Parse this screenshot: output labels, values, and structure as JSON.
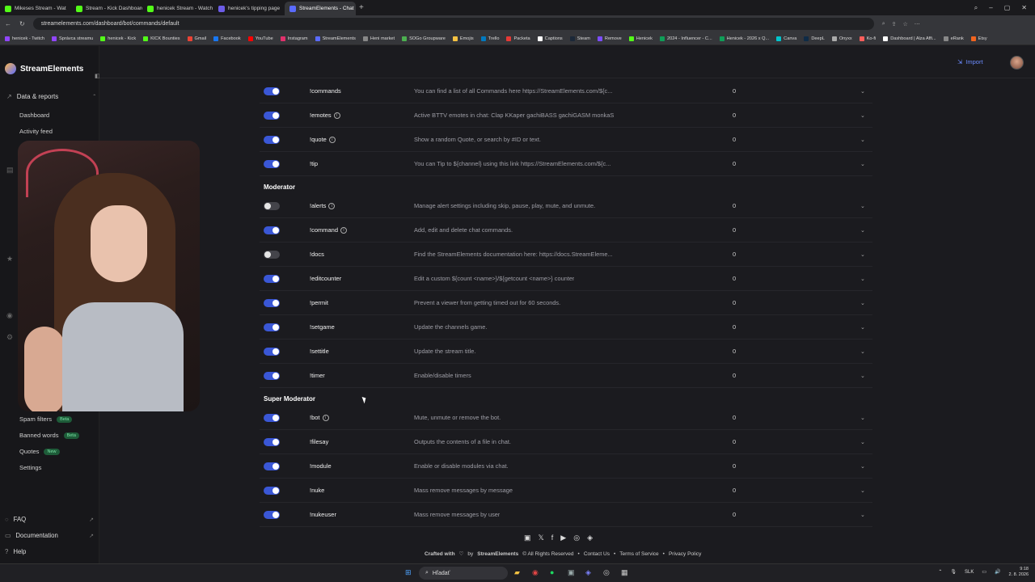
{
  "browser": {
    "tabs": [
      {
        "label": "Mikeses Stream - Wat",
        "color": "#53fc18"
      },
      {
        "label": "Stream - Kick Dashboard",
        "color": "#53fc18"
      },
      {
        "label": "henicek Stream - Watch",
        "color": "#53fc18"
      },
      {
        "label": "henicek's tipping page",
        "color": "#6c5ce7"
      },
      {
        "label": "StreamElements - Chat",
        "color": "#5a6bff"
      }
    ],
    "url": "streamelements.com/dashboard/bot/commands/default",
    "bookmarks": [
      "henicek - Twitch",
      "Správca streamu",
      "henicek - Kick",
      "KICK Bounties",
      "Gmail",
      "Facebook",
      "YouTube",
      "Instagram",
      "StreamElements",
      "Heni market",
      "SOGo Groupware",
      "Emojis",
      "Trello",
      "Packeta",
      "Captions",
      "Steam",
      "Remove",
      "Henicek",
      "2024 - Influencer - C...",
      "Henicek - 2026 x Q...",
      "Canva",
      "DeepL",
      "Onyxx",
      "Ko-fi",
      "Dashboard | Alza Affi...",
      "eRank",
      "Etsy"
    ]
  },
  "app": {
    "brand": "StreamElements",
    "import_label": "Import",
    "sidebar": {
      "section": "Data & reports",
      "items_top": [
        "Dashboard",
        "Activity feed"
      ],
      "items_bottom": [
        {
          "label": "Spam filters",
          "badge": "Beta"
        },
        {
          "label": "Banned words",
          "badge": "Beta"
        },
        {
          "label": "Quotes",
          "badge": "New"
        },
        {
          "label": "Settings",
          "badge": ""
        }
      ],
      "footer_links": [
        "FAQ",
        "Documentation",
        "Help"
      ]
    },
    "groups": {
      "moderator": "Moderator",
      "super_moderator": "Super Moderator"
    },
    "commands_everyone": [
      {
        "name": "!commands",
        "desc": "You can find a list of all Commands here https://StreamElements.com/${c...",
        "count": "0",
        "on": true,
        "info": false
      },
      {
        "name": "!emotes",
        "desc": "Active BTTV emotes in chat: Clap KKaper gachiBASS gachiGASM monkaS",
        "count": "0",
        "on": true,
        "info": true
      },
      {
        "name": "!quote",
        "desc": "Show a random Quote, or search by #ID or text.",
        "count": "0",
        "on": true,
        "info": true
      },
      {
        "name": "!tip",
        "desc": "You can Tip to ${channel} using this link https://StreamElements.com/${c...",
        "count": "0",
        "on": true,
        "info": false
      }
    ],
    "commands_moderator": [
      {
        "name": "!alerts",
        "desc": "Manage alert settings including skip, pause, play, mute, and unmute.",
        "count": "0",
        "on": false,
        "info": true
      },
      {
        "name": "!command",
        "desc": "Add, edit and delete chat commands.",
        "count": "0",
        "on": true,
        "info": true
      },
      {
        "name": "!docs",
        "desc": "Find the StreamElements documentation here: https://docs.StreamEleme...",
        "count": "0",
        "on": false,
        "info": false
      },
      {
        "name": "!editcounter",
        "desc": "Edit a custom ${count <name>}/${getcount <name>} counter",
        "count": "0",
        "on": true,
        "info": false
      },
      {
        "name": "!permit",
        "desc": "Prevent a viewer from getting timed out for 60 seconds.",
        "count": "0",
        "on": true,
        "info": false
      },
      {
        "name": "!setgame",
        "desc": "Update the channels game.",
        "count": "0",
        "on": true,
        "info": false
      },
      {
        "name": "!settitle",
        "desc": "Update the stream title.",
        "count": "0",
        "on": true,
        "info": false
      },
      {
        "name": "!timer",
        "desc": "Enable/disable timers",
        "count": "0",
        "on": true,
        "info": false
      }
    ],
    "commands_super": [
      {
        "name": "!bot",
        "desc": "Mute, unmute or remove the bot.",
        "count": "0",
        "on": true,
        "info": true
      },
      {
        "name": "!filesay",
        "desc": "Outputs the contents of a file in chat.",
        "count": "0",
        "on": true,
        "info": false
      },
      {
        "name": "!module",
        "desc": "Enable or disable modules via chat.",
        "count": "0",
        "on": true,
        "info": false
      },
      {
        "name": "!nuke",
        "desc": "Mass remove messages by message",
        "count": "0",
        "on": true,
        "info": false
      },
      {
        "name": "!nukeuser",
        "desc": "Mass remove messages by user",
        "count": "0",
        "on": true,
        "info": false
      }
    ],
    "footer": {
      "crafted": "Crafted with",
      "by": "by",
      "brand": "StreamElements",
      "rights": "© All Rights Reserved",
      "contact": "Contact Us",
      "terms": "Terms of Service",
      "privacy": "Privacy Policy"
    }
  },
  "taskbar": {
    "search_placeholder": "Hľadať",
    "lang": "SLK",
    "time": "9:18",
    "date": "2. 8. 2026"
  }
}
